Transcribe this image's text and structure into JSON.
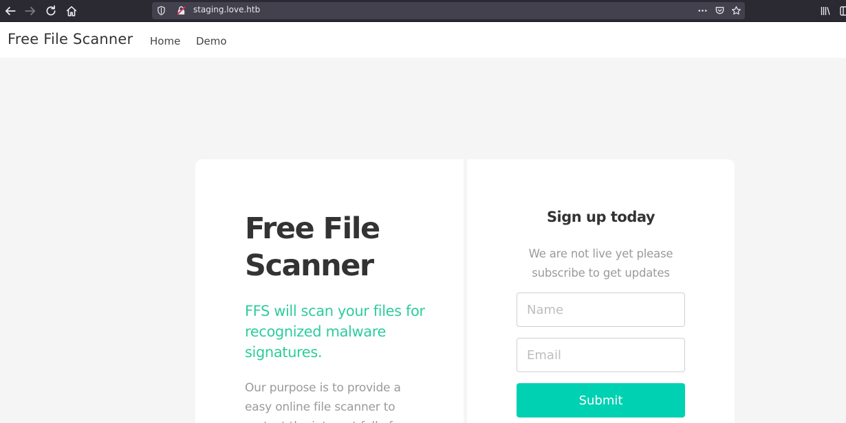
{
  "browser": {
    "url": "staging.love.htb"
  },
  "navbar": {
    "brand": "Free File Scanner",
    "links": [
      {
        "label": "Home"
      },
      {
        "label": "Demo"
      }
    ]
  },
  "hero": {
    "title": "Free File Scanner",
    "subtitle": "FFS will scan your files for recognized malware signatures.",
    "description": "Our purpose is to provide a easy online file scanner to protect the internet full of"
  },
  "signup": {
    "title": "Sign up today",
    "text": "We are not live yet please subscribe to get updates",
    "name_placeholder": "Name",
    "name_value": "",
    "email_placeholder": "Email",
    "email_value": "",
    "submit_label": "Submit"
  },
  "colors": {
    "accent": "#00d1b2",
    "subtitle": "#2ecc9c",
    "page_background": "#f5f5f5",
    "browser_chrome": "#2b2a33"
  },
  "icons": {
    "back": "arrow-left-icon",
    "forward": "arrow-right-icon",
    "reload": "reload-icon",
    "home": "home-icon",
    "shield": "shield-icon",
    "insecure_lock": "insecure-lock-icon",
    "more": "more-dots-icon",
    "pocket": "pocket-icon",
    "bookmark": "star-icon",
    "library": "library-icon",
    "reader": "reader-icon"
  }
}
